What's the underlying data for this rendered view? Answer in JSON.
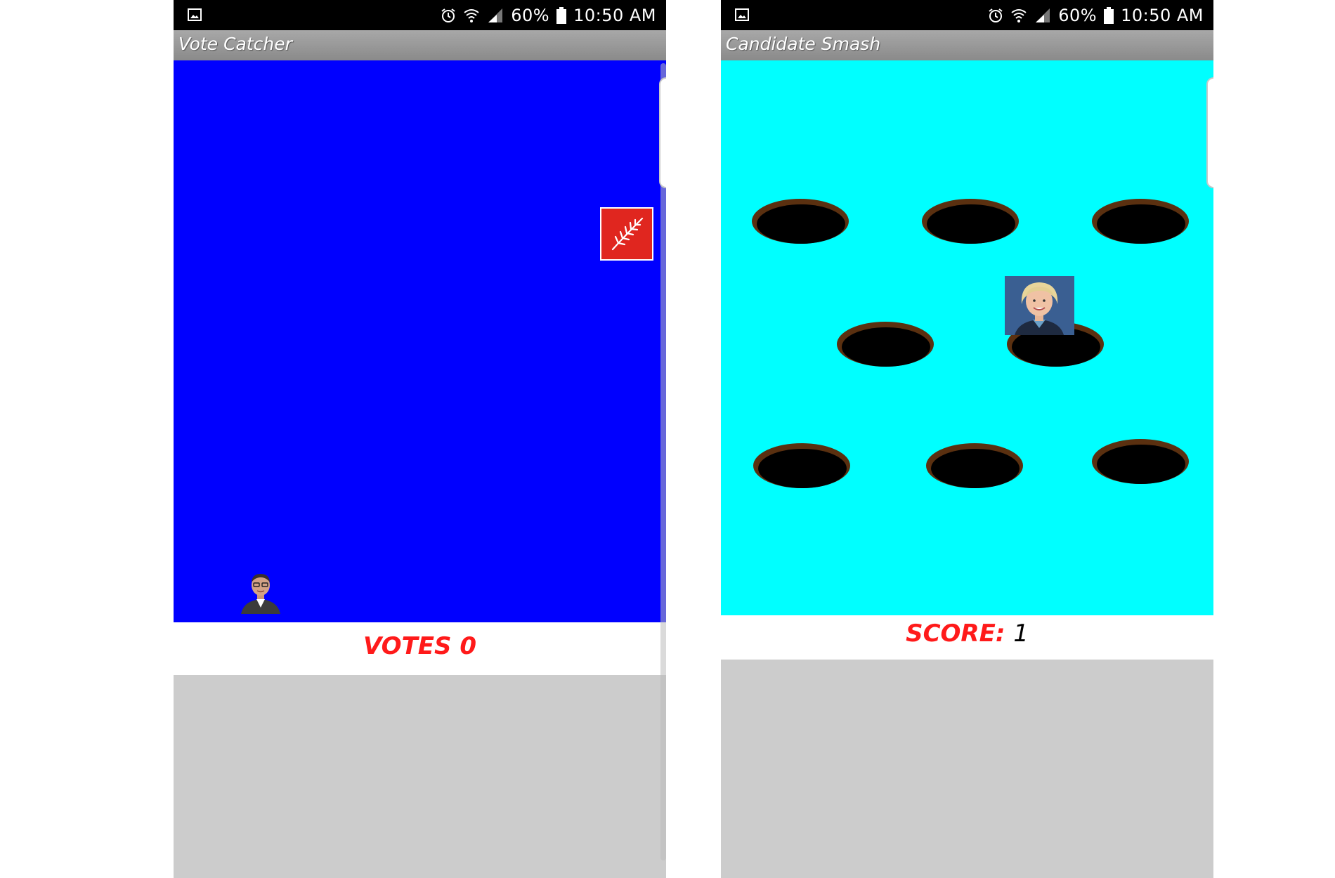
{
  "status_bar": {
    "battery": "60%",
    "time": "10:50 AM"
  },
  "vote_catcher": {
    "title": "Vote Catcher",
    "score_label": "VOTES",
    "score_value": "0",
    "colors": {
      "background": "#0000ff",
      "tile": "#e0261f",
      "score": "#ff1a1a"
    }
  },
  "candidate_smash": {
    "title": "Candidate Smash",
    "score_label": "SCORE:",
    "score_value": "1",
    "holes": 8,
    "colors": {
      "background": "#00ffff",
      "hole_rim": "#5a3010",
      "score": "#ff1a1a"
    }
  },
  "icons": [
    "image-icon",
    "alarm-icon",
    "wifi-icon",
    "signal-icon",
    "battery-icon",
    "fern-icon"
  ]
}
